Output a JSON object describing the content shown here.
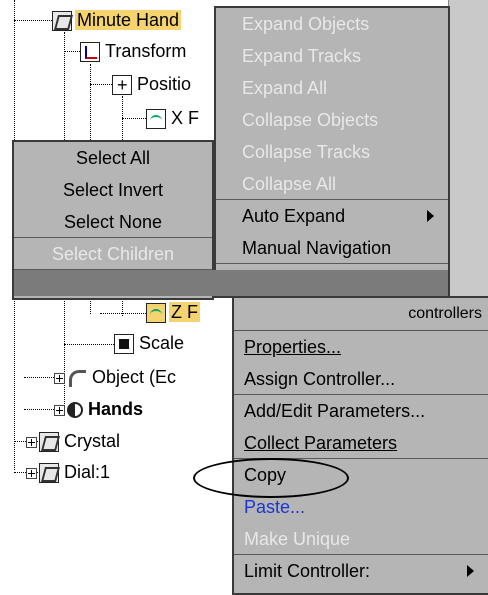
{
  "tree": {
    "nodes": [
      {
        "label": "Minute Hand",
        "icon": "object-icon"
      },
      {
        "label": "Transform",
        "icon": "transform-icon"
      },
      {
        "label": "Positio",
        "icon": "position-icon"
      },
      {
        "label": "X F",
        "icon": "curve-icon"
      },
      {
        "label": "Z F",
        "icon": "curve-icon"
      },
      {
        "label": "Scale",
        "icon": "scale-icon"
      },
      {
        "label": "Object (Ec",
        "icon": "modifier-icon"
      },
      {
        "label": "Hands",
        "icon": "hands-icon"
      },
      {
        "label": "Crystal",
        "icon": "object-icon"
      },
      {
        "label": "Dial:1",
        "icon": "object-icon"
      }
    ]
  },
  "menu_expand": {
    "items": [
      {
        "label": "Expand Objects",
        "enabled": false
      },
      {
        "label": "Expand Tracks",
        "enabled": false
      },
      {
        "label": "Expand All",
        "enabled": false
      },
      {
        "label": "Collapse Objects",
        "enabled": false
      },
      {
        "label": "Collapse Tracks",
        "enabled": false
      },
      {
        "label": "Collapse All",
        "enabled": false
      },
      {
        "label": "Auto Expand",
        "enabled": true,
        "submenu": true
      },
      {
        "label": "Manual Navigation",
        "enabled": true
      }
    ]
  },
  "menu_select": {
    "items": [
      {
        "label": "Select All",
        "enabled": true
      },
      {
        "label": "Select Invert",
        "enabled": true
      },
      {
        "label": "Select None",
        "enabled": true
      },
      {
        "label": "Select Children",
        "enabled": false
      }
    ]
  },
  "menu_controllers": {
    "title": "controllers",
    "items": [
      {
        "label": "Properties...",
        "enabled": true
      },
      {
        "label": "Assign Controller...",
        "enabled": true
      },
      {
        "label": "Add/Edit Parameters...",
        "enabled": true
      },
      {
        "label": "Collect Parameters",
        "enabled": true
      },
      {
        "label": "Copy",
        "enabled": true,
        "highlighted_by_oval": true
      },
      {
        "label": "Paste...",
        "enabled": true,
        "color": "#1a36d6"
      },
      {
        "label": "Make Unique",
        "enabled": false
      },
      {
        "label": "Limit Controller:",
        "enabled": true,
        "submenu": true
      }
    ]
  },
  "colors": {
    "menu_bg": "#b5b5b5",
    "disabled_text": "#e8e8e8",
    "selection_highlight": "#f5d36e",
    "link_blue": "#1a36d6"
  }
}
